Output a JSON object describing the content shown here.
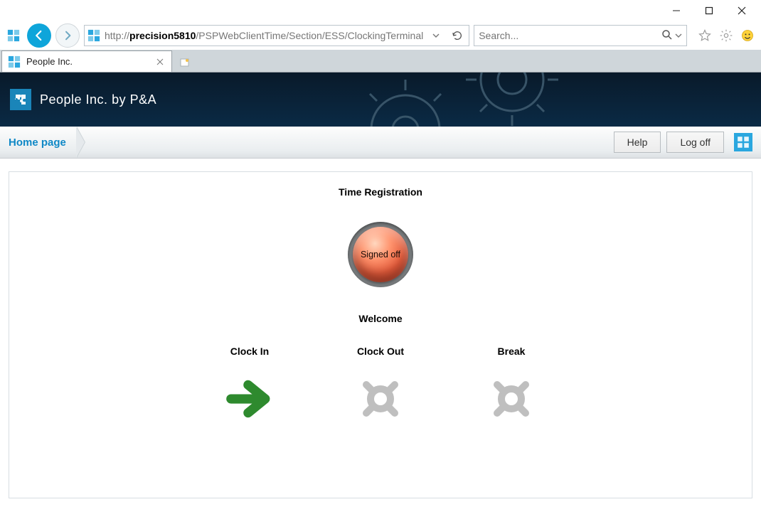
{
  "window": {
    "minimize": "minimize-icon",
    "maximize": "maximize-icon",
    "close": "close-icon"
  },
  "url": {
    "host": "precision5810",
    "prefix": "http://",
    "path": "/PSPWebClientTime/Section/ESS/ClockingTerminal"
  },
  "search": {
    "placeholder": "Search..."
  },
  "tab": {
    "title": "People Inc."
  },
  "app_header": {
    "title": "People Inc. by P&A"
  },
  "toolbar": {
    "home_label": "Home page",
    "help_label": "Help",
    "logoff_label": "Log off"
  },
  "panel": {
    "title": "Time Registration",
    "status_text": "Signed off",
    "welcome": "Welcome",
    "actions": [
      {
        "label": "Clock In"
      },
      {
        "label": "Clock Out"
      },
      {
        "label": "Break"
      }
    ]
  }
}
